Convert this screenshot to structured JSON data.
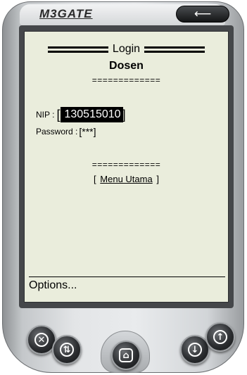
{
  "header": {
    "brand": "M3GATE",
    "back_icon": "back-arrow-icon"
  },
  "screen": {
    "title": "Login",
    "subtitle": "Dosen",
    "separator_top": "=============",
    "nip_label": "NIP :",
    "nip_bracket_open": "[",
    "nip_value": "130515010",
    "nip_bracket_close": "]",
    "password_label": "Password :",
    "password_value": "[***]",
    "separator_bottom": "=============",
    "menu_open": "[",
    "menu_link": "Menu Utama",
    "menu_close": "]",
    "options_label": "Options..."
  },
  "buttons": {
    "close_icon": "x-icon",
    "swap_icon": "swap-icon",
    "home_icon": "home-icon",
    "down_icon": "arrow-down-icon",
    "up_icon": "arrow-up-icon",
    "close_glyph": "✕",
    "swap_glyph": "⇅",
    "home_glyph": "⌂",
    "down_glyph": "↓",
    "up_glyph": "↑",
    "back_glyph": "⟵"
  },
  "colors": {
    "screen_bg": "#eaeddc",
    "device_body": "#e3e5e7",
    "buttons": "#1b1c1e"
  }
}
